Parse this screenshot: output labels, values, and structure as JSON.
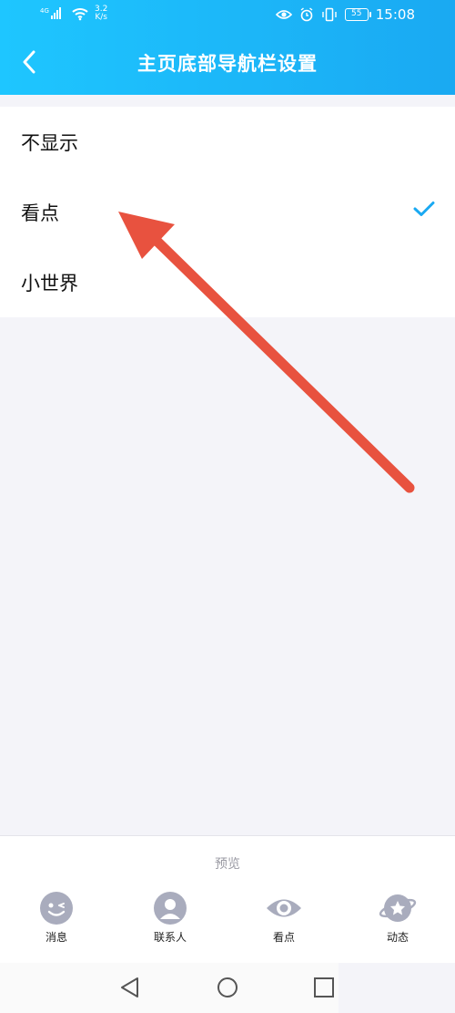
{
  "status_bar": {
    "network": "4G",
    "speed_value": "3.2",
    "speed_unit": "K/s",
    "battery": "55",
    "time": "15:08"
  },
  "header": {
    "title": "主页底部导航栏设置"
  },
  "options": [
    {
      "label": "不显示",
      "selected": false
    },
    {
      "label": "看点",
      "selected": true
    },
    {
      "label": "小世界",
      "selected": false
    }
  ],
  "preview": {
    "label": "预览",
    "tabs": [
      {
        "label": "消息",
        "icon": "message-icon"
      },
      {
        "label": "联系人",
        "icon": "contacts-icon"
      },
      {
        "label": "看点",
        "icon": "eye-icon"
      },
      {
        "label": "动态",
        "icon": "planet-icon"
      }
    ]
  },
  "colors": {
    "header_start": "#1ec6ff",
    "header_end": "#1aa9f2",
    "check": "#1aa9f2",
    "arrow": "#e8523f",
    "tab_icon": "#a9acbd"
  }
}
